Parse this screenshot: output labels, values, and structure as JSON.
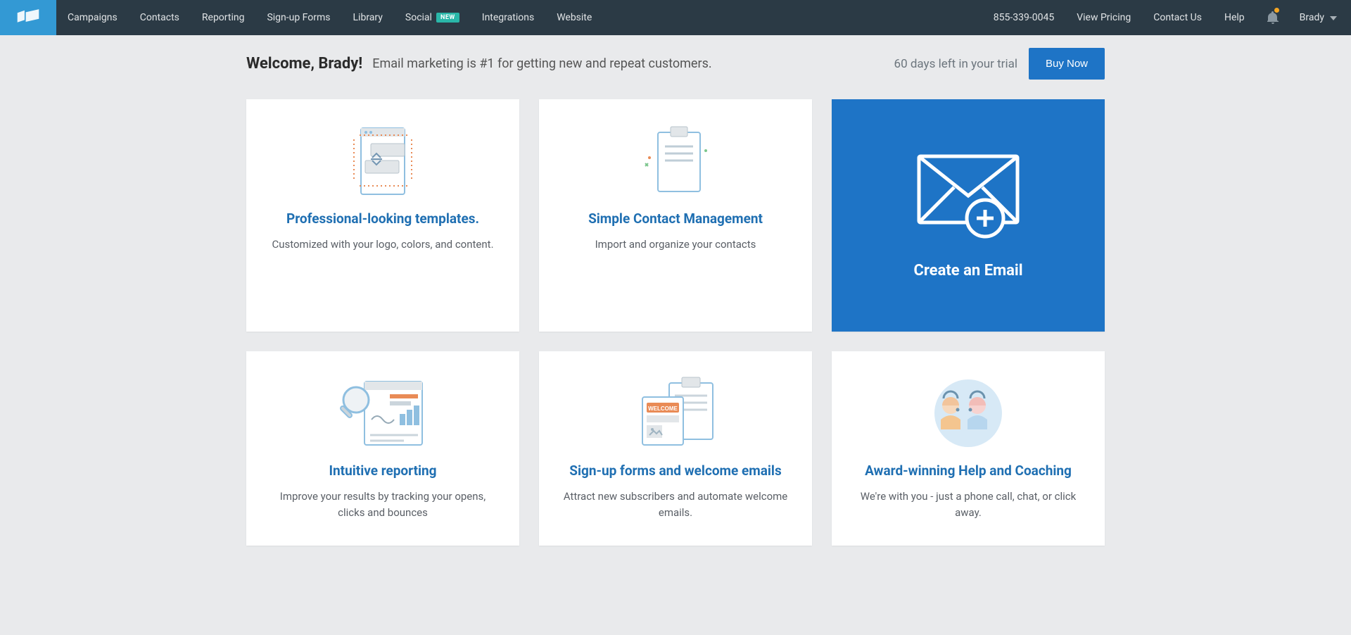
{
  "nav": {
    "items_left": [
      {
        "label": "Campaigns"
      },
      {
        "label": "Contacts"
      },
      {
        "label": "Reporting"
      },
      {
        "label": "Sign-up Forms"
      },
      {
        "label": "Library"
      },
      {
        "label": "Social",
        "badge": "NEW"
      },
      {
        "label": "Integrations"
      },
      {
        "label": "Website"
      }
    ],
    "items_right": [
      {
        "label": "855-339-0045"
      },
      {
        "label": "View Pricing"
      },
      {
        "label": "Contact Us"
      },
      {
        "label": "Help"
      }
    ],
    "user": "Brady"
  },
  "welcome": {
    "title": "Welcome, Brady!",
    "subtitle": "Email marketing is #1 for getting new and repeat customers."
  },
  "trial": {
    "text": "60 days left in your trial",
    "cta": "Buy Now"
  },
  "cards": [
    {
      "title": "Professional-looking templates.",
      "desc": "Customized with your logo, colors, and content."
    },
    {
      "title": "Simple Contact Management",
      "desc": "Import and organize your contacts"
    },
    {
      "title": "Create an Email"
    },
    {
      "title": "Intuitive reporting",
      "desc": "Improve your results by tracking your opens, clicks and bounces"
    },
    {
      "title": "Sign-up forms and welcome emails",
      "desc": "Attract new subscribers and automate welcome emails."
    },
    {
      "title": "Award-winning Help and Coaching",
      "desc": "We're with you - just a phone call, chat, or click away."
    }
  ]
}
